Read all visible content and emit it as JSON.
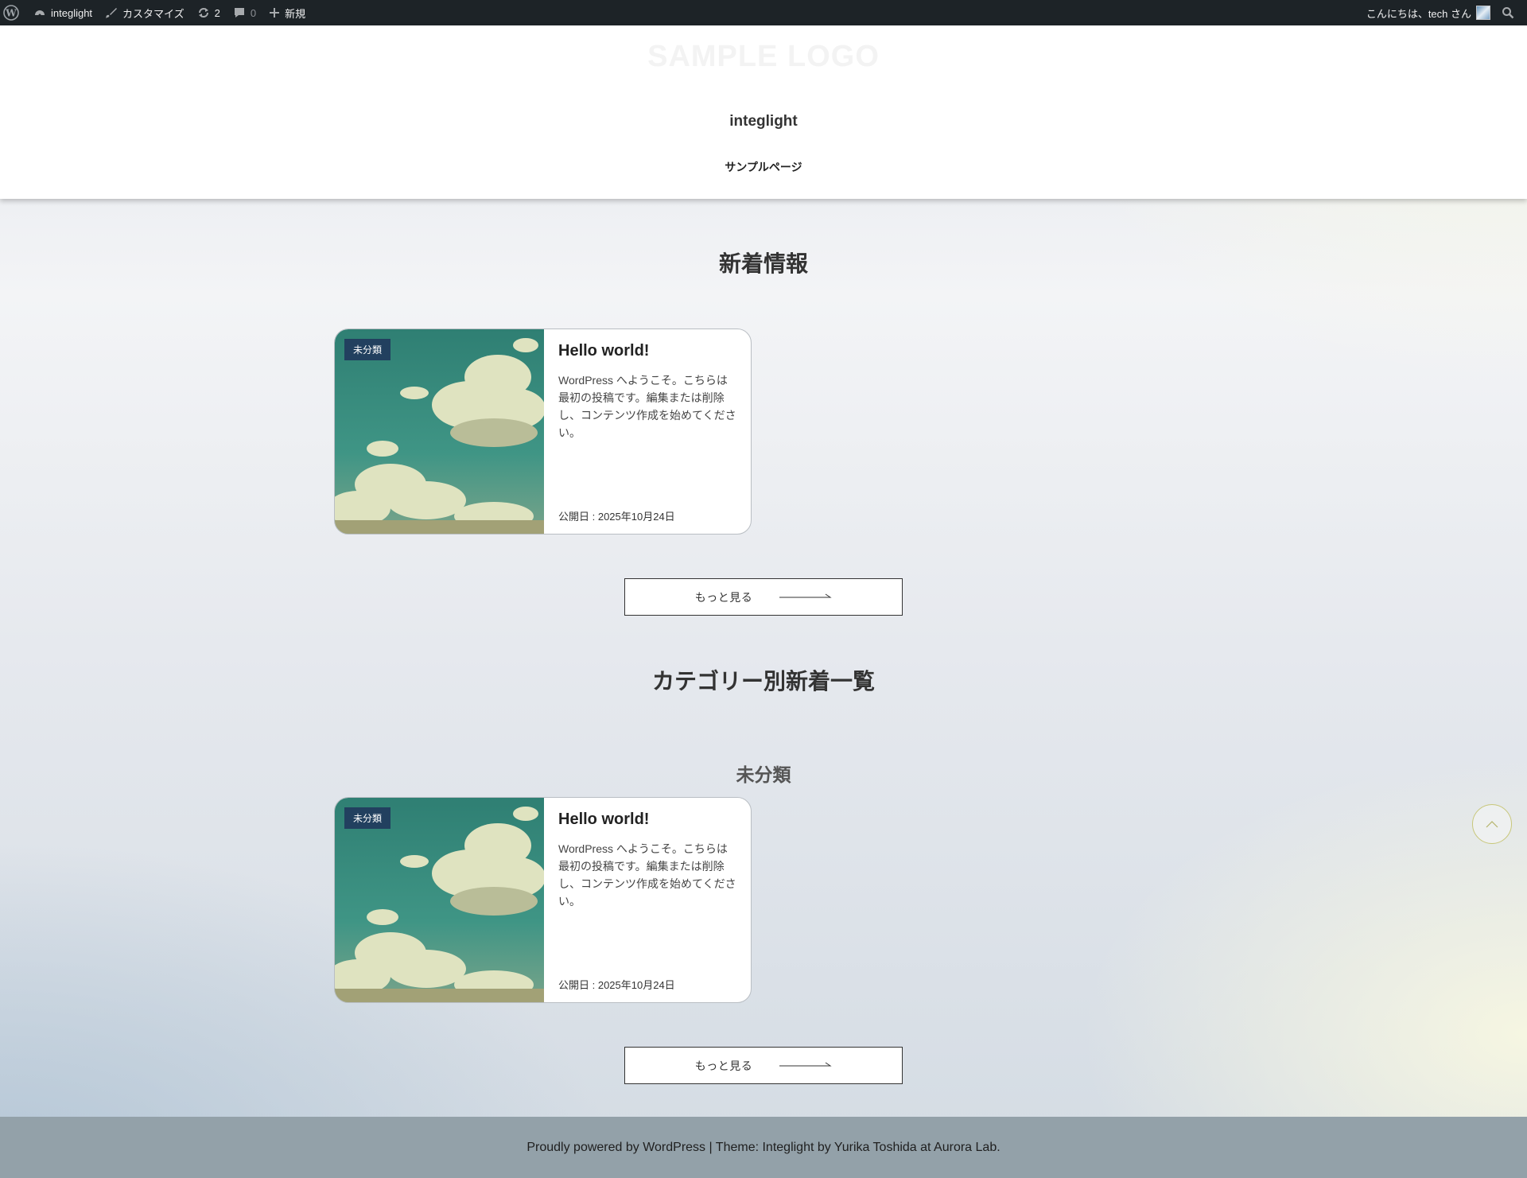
{
  "admin_bar": {
    "site_name": "integlight",
    "customize": "カスタマイズ",
    "updates_count": "2",
    "comments_count": "0",
    "new": "新規",
    "greeting": "こんにちは、tech さん"
  },
  "header": {
    "logo_text": "SAMPLE LOGO",
    "site_title": "integlight",
    "nav": [
      "サンプルページ"
    ]
  },
  "sections": {
    "latest_title": "新着情報",
    "category_title": "カテゴリー別新着一覧",
    "category_name": "未分類"
  },
  "posts": [
    {
      "category": "未分類",
      "title": "Hello world!",
      "excerpt": "WordPress へようこそ。こちらは最初の投稿です。編集または削除し、コンテンツ作成を始めてください。",
      "date": "公開日 : 2025年10月24日"
    }
  ],
  "more_label": "もっと見る",
  "footer": {
    "text": "Proudly powered by WordPress | Theme: Integlight by Yurika Toshida at Aurora Lab."
  },
  "colors": {
    "admin_bar": "#1d2327",
    "badge": "#22405f",
    "footer": "#93a1a9"
  }
}
